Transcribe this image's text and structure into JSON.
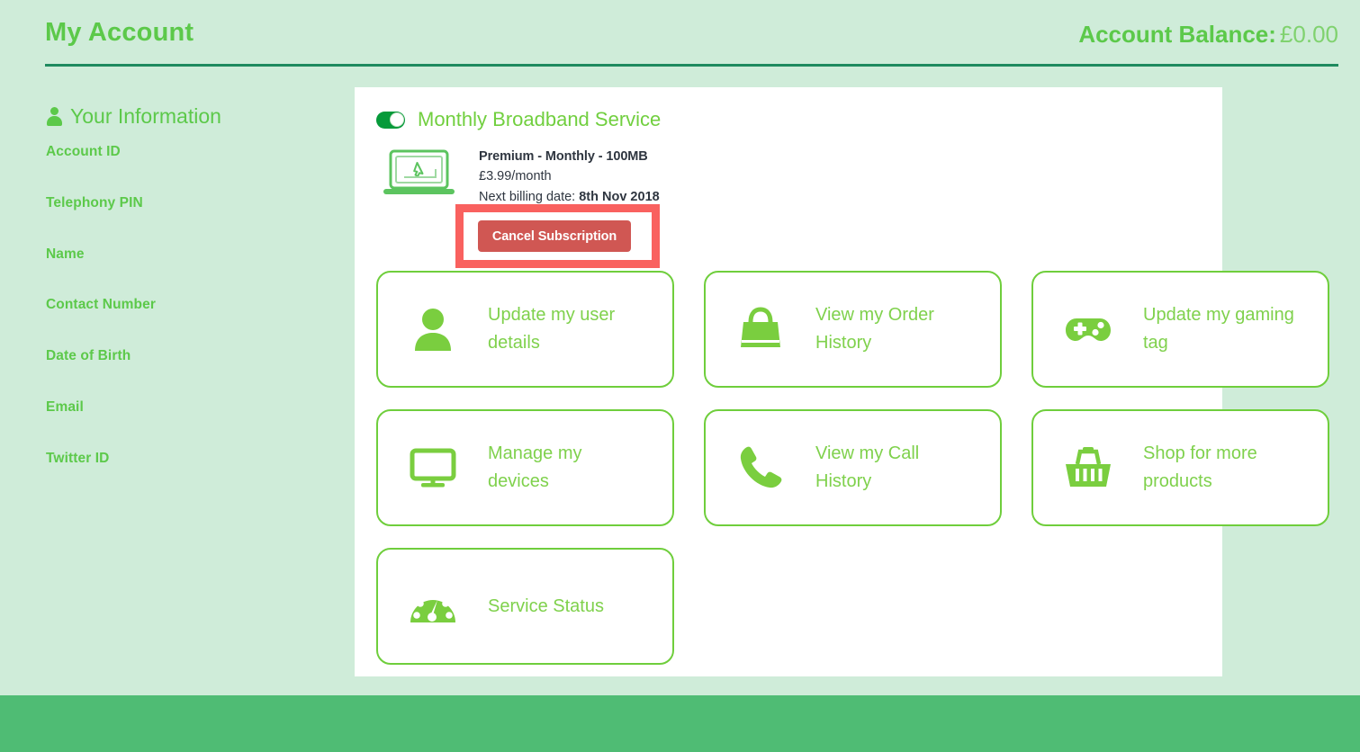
{
  "header": {
    "title": "My Account",
    "balance_label": "Account Balance:",
    "balance_value": "£0.00"
  },
  "sidebar": {
    "heading": "Your Information",
    "heading_icon": "person-icon",
    "fields": [
      {
        "label": "Account ID",
        "value": ""
      },
      {
        "label": "Telephony PIN",
        "value": ""
      },
      {
        "label": "Name",
        "value": ""
      },
      {
        "label": "Contact Number",
        "value": ""
      },
      {
        "label": "Date of Birth",
        "value": ""
      },
      {
        "label": "Email",
        "value": ""
      },
      {
        "label": "Twitter ID",
        "value": ""
      }
    ]
  },
  "subscription": {
    "toggle_state": "on",
    "title": "Monthly Broadband Service",
    "device_icon": "laptop-icon",
    "plan_name": "Premium - Monthly - 100MB",
    "plan_price": "£3.99/month",
    "billing_label": "Next billing date:",
    "billing_date": "8th Nov 2018",
    "cancel_label": "Cancel Subscription"
  },
  "cards": [
    {
      "icon": "user-icon",
      "label": "Update my user details"
    },
    {
      "icon": "bag-icon",
      "label": "View my Order History"
    },
    {
      "icon": "gamepad-icon",
      "label": "Update my gaming tag"
    },
    {
      "icon": "monitor-icon",
      "label": "Manage my devices"
    },
    {
      "icon": "phone-icon",
      "label": "View my Call History"
    },
    {
      "icon": "basket-icon",
      "label": "Shop for more products"
    },
    {
      "icon": "speedometer-icon",
      "label": "Service Status"
    }
  ],
  "colors": {
    "page_background": "#cfecd9",
    "brand_green": "#5cc94a",
    "card_green": "#7fd14c",
    "toggle_on": "#069a3a",
    "header_rule": "#1f8a5f",
    "footer_band": "#4fbc74",
    "cancel_button": "#d05753",
    "annotation_red": "#f9615f",
    "panel_background": "#ffffff"
  }
}
